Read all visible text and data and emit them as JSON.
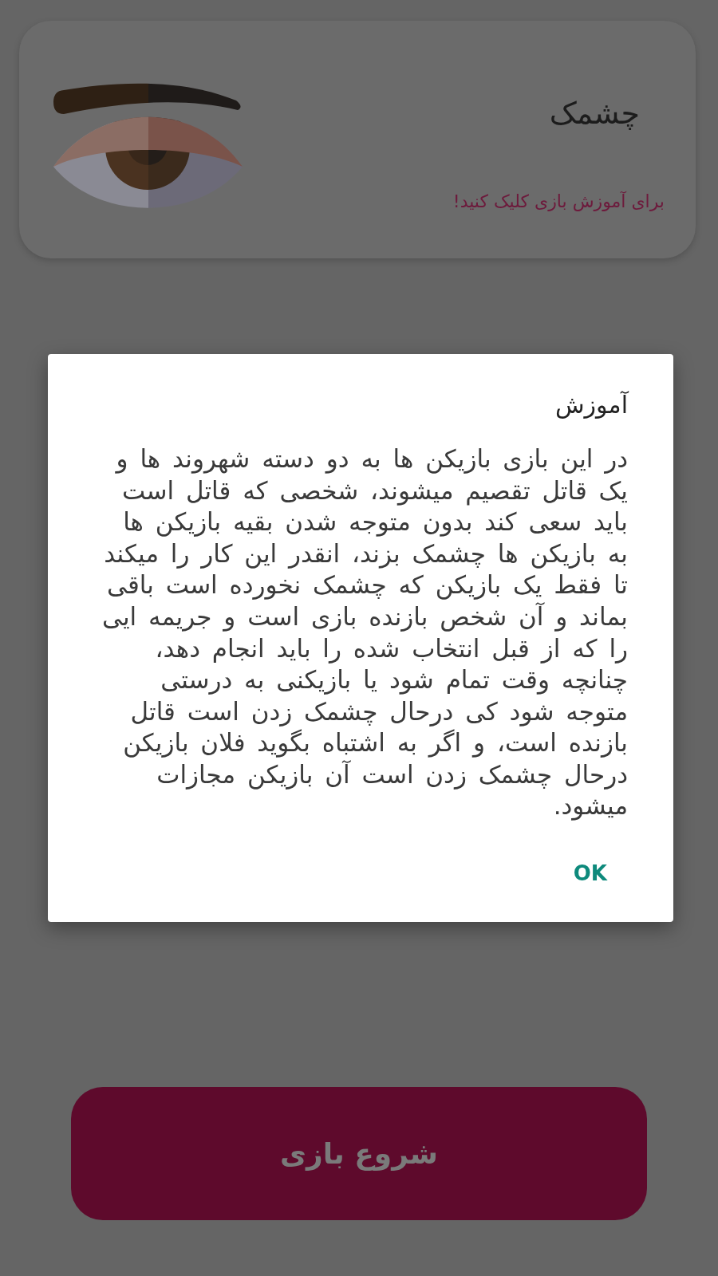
{
  "card": {
    "title": "چشمک",
    "subtitle": "برای آموزش بازی کلیک کنید!"
  },
  "dialog": {
    "title": "آموزش",
    "body": "در این بازی بازیکن ها به دو دسته شهروند ها و یک قاتل تقصیم میشوند، شخصی که قاتل است باید سعی کند بدون متوجه شدن بقیه بازیکن ها به بازیکن ها چشمک بزند، انقدر این کار را میکند تا فقط یک بازیکن که چشمک نخورده است باقی بماند و آن شخص بازنده بازی است و جریمه ایی را که از قبل انتخاب شده را باید انجام دهد، چنانچه وقت تمام شود یا بازیکنی به درستی متوجه شود کی درحال چشمک زدن است قاتل بازنده است، و اگر به اشتباه بگوید فلان بازیکن درحال چشمک زدن است آن بازیکن مجازات میشود.",
    "buttons": [
      "OK"
    ]
  },
  "start_button": {
    "label": "شروع بازی"
  }
}
